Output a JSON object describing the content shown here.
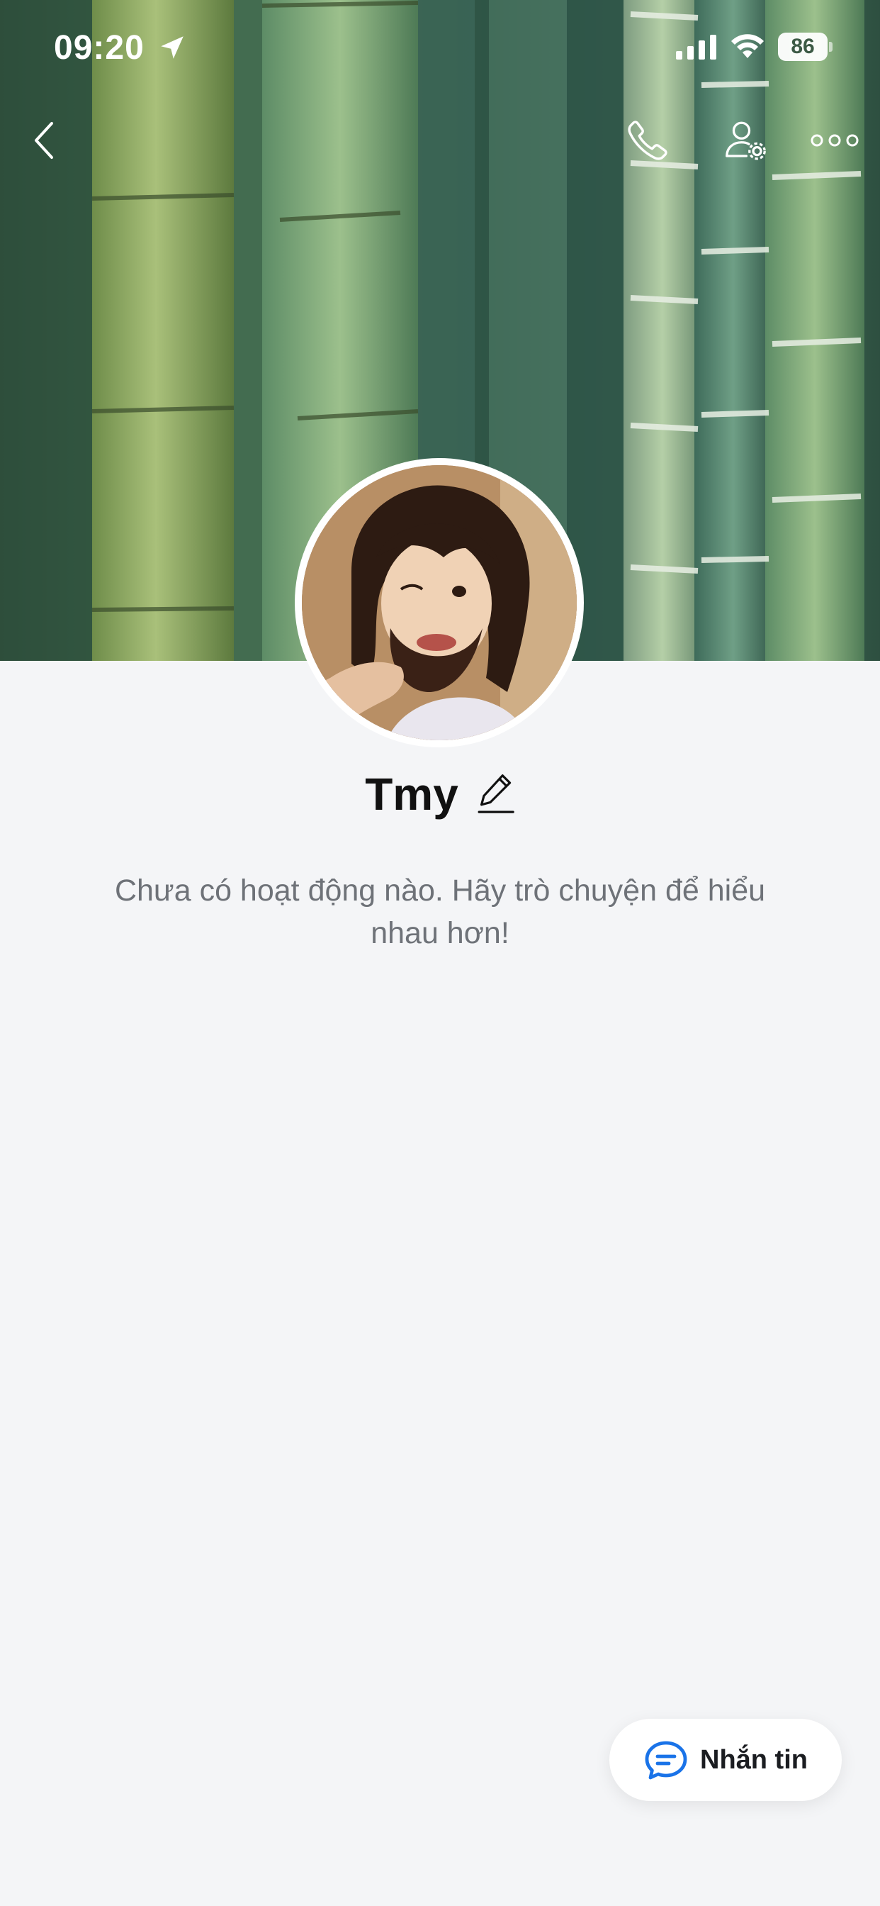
{
  "status_bar": {
    "time": "09:20",
    "battery_level": "86",
    "icons": [
      "location-arrow-icon",
      "cellular-signal-icon",
      "wifi-icon",
      "battery-icon"
    ]
  },
  "header": {
    "icons": [
      "chevron-left-icon",
      "phone-icon",
      "contact-settings-icon",
      "more-horizontal-icon"
    ]
  },
  "profile": {
    "name": "Tmy",
    "edit_icon": "pencil-icon",
    "empty_activity_text": "Chưa có hoạt động nào. Hãy trò chuyện để hiểu nhau hơn!"
  },
  "actions": {
    "message_label": "Nhắn tin",
    "message_icon": "chat-bubble-icon"
  },
  "colors": {
    "background": "#f4f5f7",
    "accent": "#1a73e8",
    "text_primary": "#111111",
    "text_secondary": "#6e7278"
  }
}
